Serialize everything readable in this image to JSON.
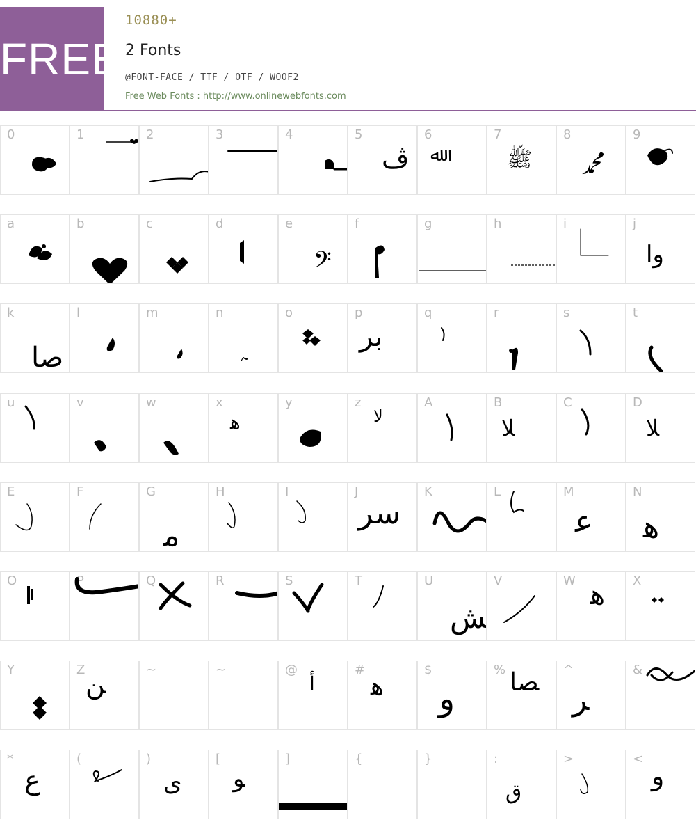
{
  "header": {
    "badge": "FREE",
    "count": "10880+",
    "font_name": "2 Fonts",
    "formats": "@FONT-FACE / TTF / OTF / WOOF2",
    "credit": "Free Web Fonts : http://www.onlinewebfonts.com",
    "accent_color": "#8e5f98"
  },
  "glyph_rows": [
    [
      "0",
      "1",
      "2",
      "3",
      "4",
      "5",
      "6",
      "7",
      "8",
      "9"
    ],
    [
      "a",
      "b",
      "c",
      "d",
      "e",
      "f",
      "g",
      "h",
      "i",
      "j"
    ],
    [
      "k",
      "l",
      "m",
      "n",
      "o",
      "p",
      "q",
      "r",
      "s",
      "t"
    ],
    [
      "u",
      "v",
      "w",
      "x",
      "y",
      "z",
      "A",
      "B",
      "C",
      "D"
    ],
    [
      "E",
      "F",
      "G",
      "H",
      "I",
      "J",
      "K",
      "L",
      "M",
      "N"
    ],
    [
      "O",
      "P",
      "Q",
      "R",
      "S",
      "T",
      "U",
      "V",
      "W",
      "X"
    ],
    [
      "Y",
      "Z",
      "~",
      "~",
      "@",
      "#",
      "$",
      "%",
      "^",
      "&"
    ],
    [
      "*",
      "(",
      ")",
      "[",
      "]",
      "{",
      "}",
      ":",
      ">",
      "<"
    ]
  ]
}
